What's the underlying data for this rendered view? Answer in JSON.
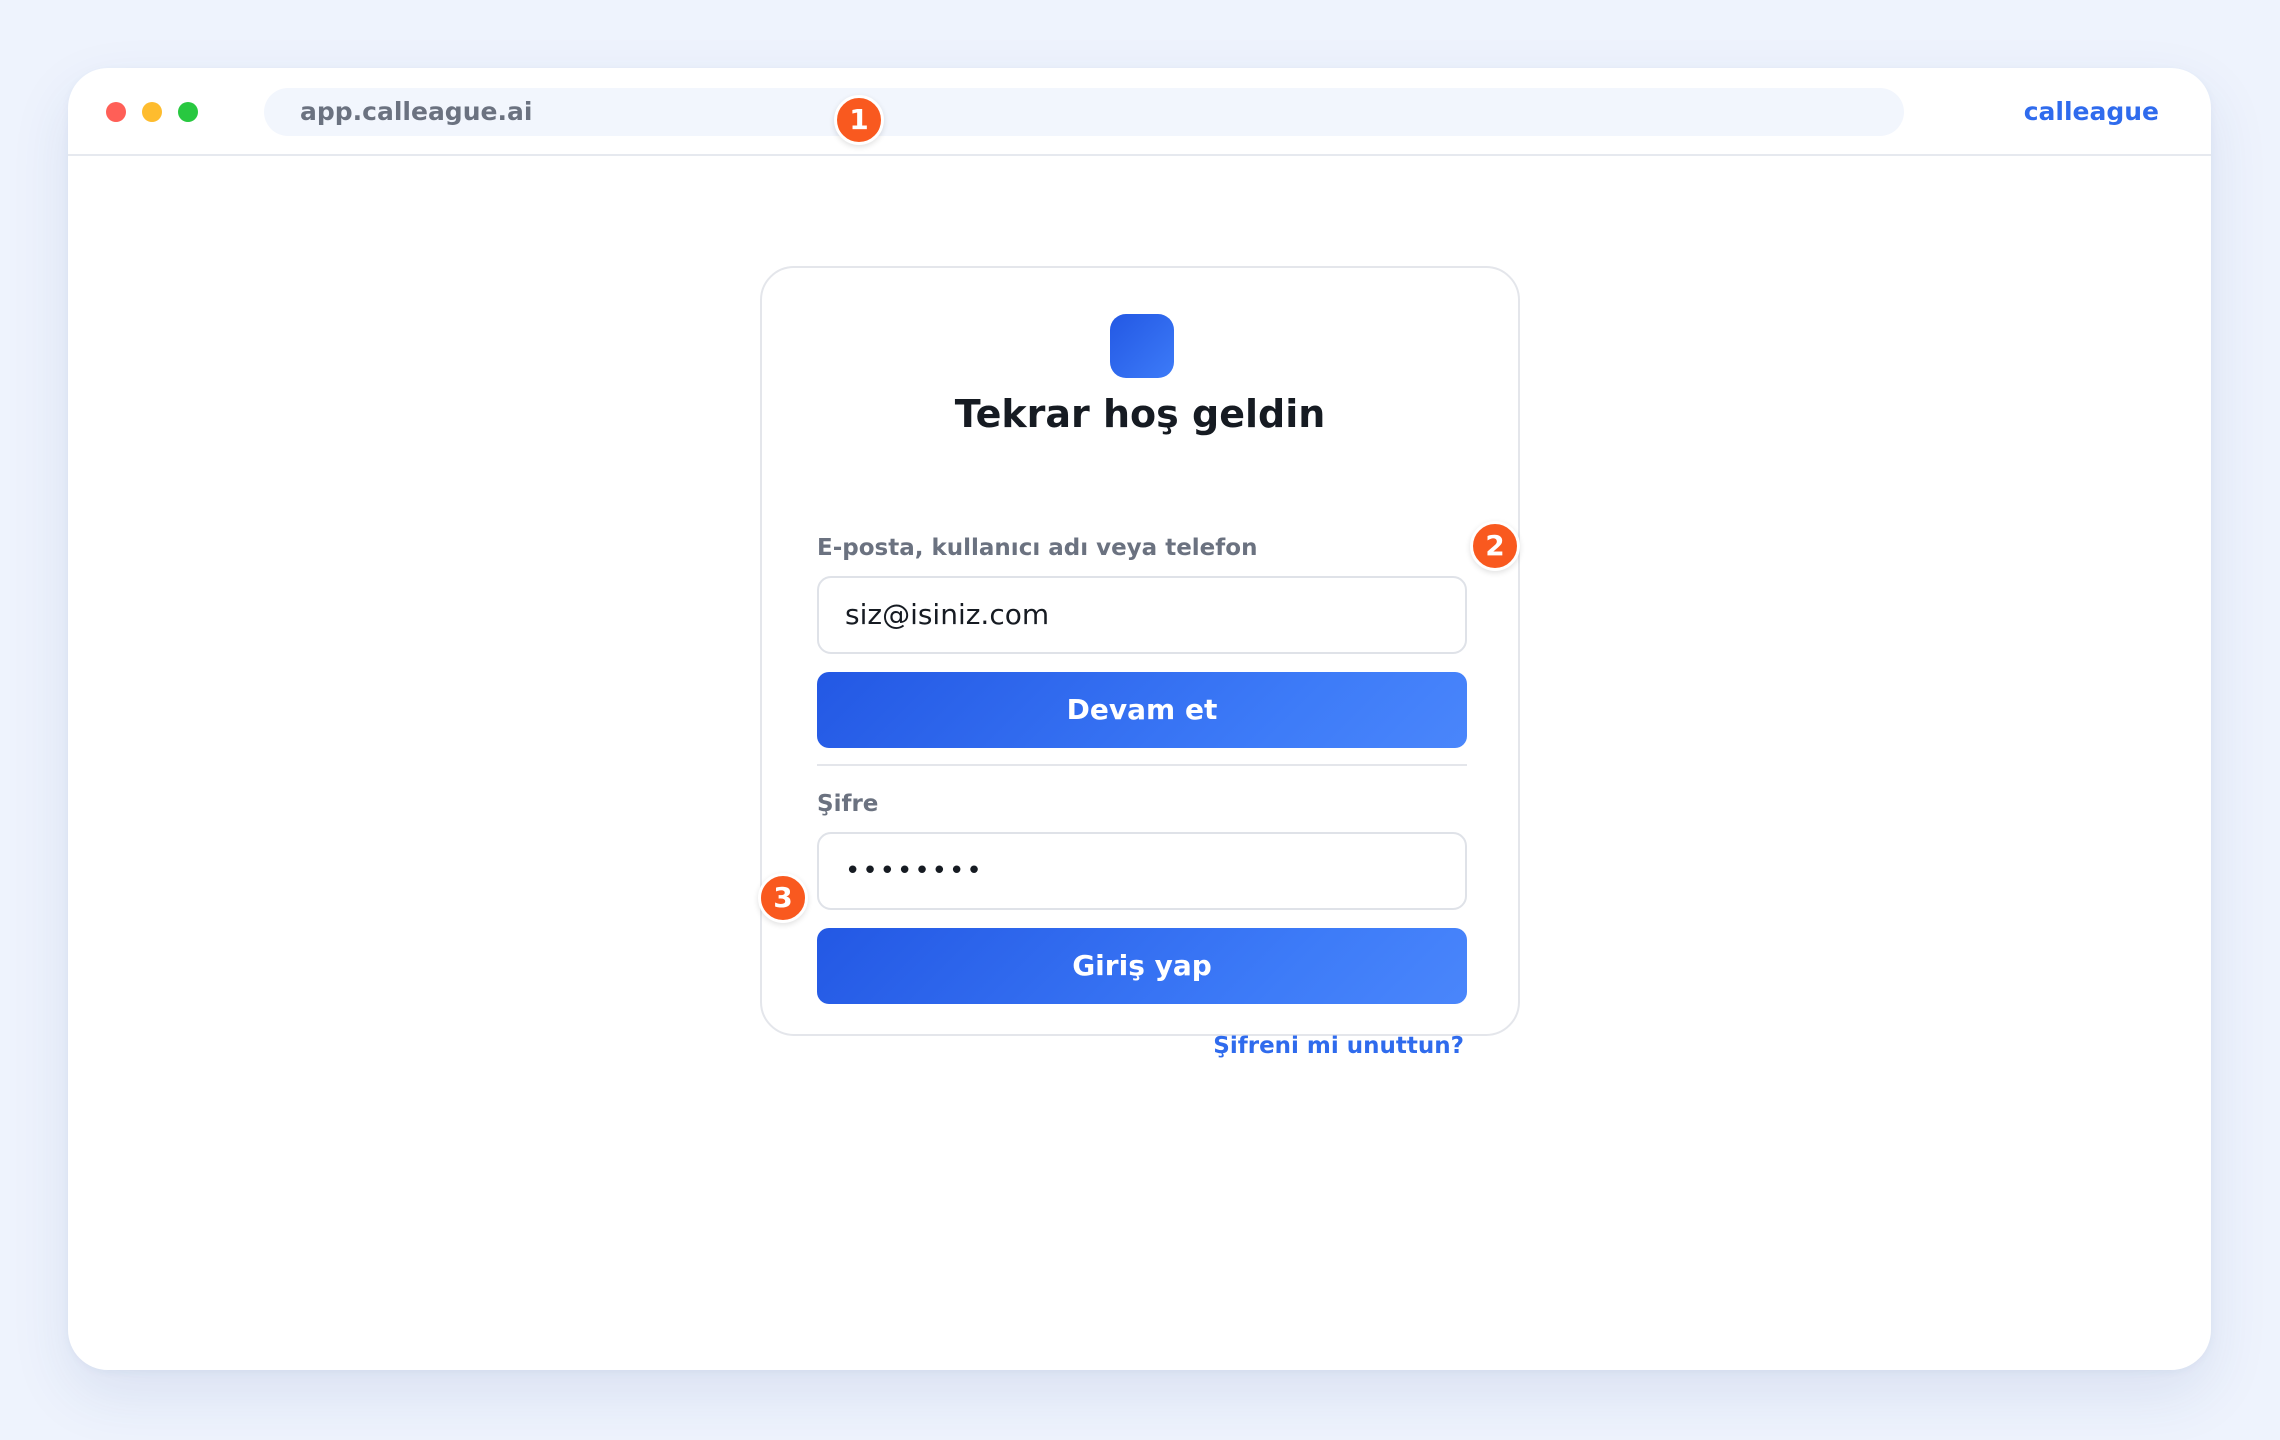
{
  "browser": {
    "url": "app.calleague.ai",
    "brand": "calleague"
  },
  "login": {
    "title": "Tekrar hoş geldin",
    "email_label": "E-posta, kullanıcı adı veya telefon",
    "email_value": "siz@isiniz.com",
    "continue_label": "Devam et",
    "password_label": "Şifre",
    "password_value": "••••••••",
    "login_label": "Giriş yap",
    "forgot_label": "Şifreni mi unuttun?"
  },
  "badges": [
    "1",
    "2",
    "3"
  ],
  "colors": {
    "accent": "#2f6bed",
    "button_gradient_start": "#2358e4",
    "button_gradient_end": "#4a86fb",
    "badge": "#f9591f"
  },
  "icons": {
    "window_controls": [
      "close-dot",
      "minimize-dot",
      "maximize-dot"
    ],
    "logo": "app-logo-icon"
  }
}
